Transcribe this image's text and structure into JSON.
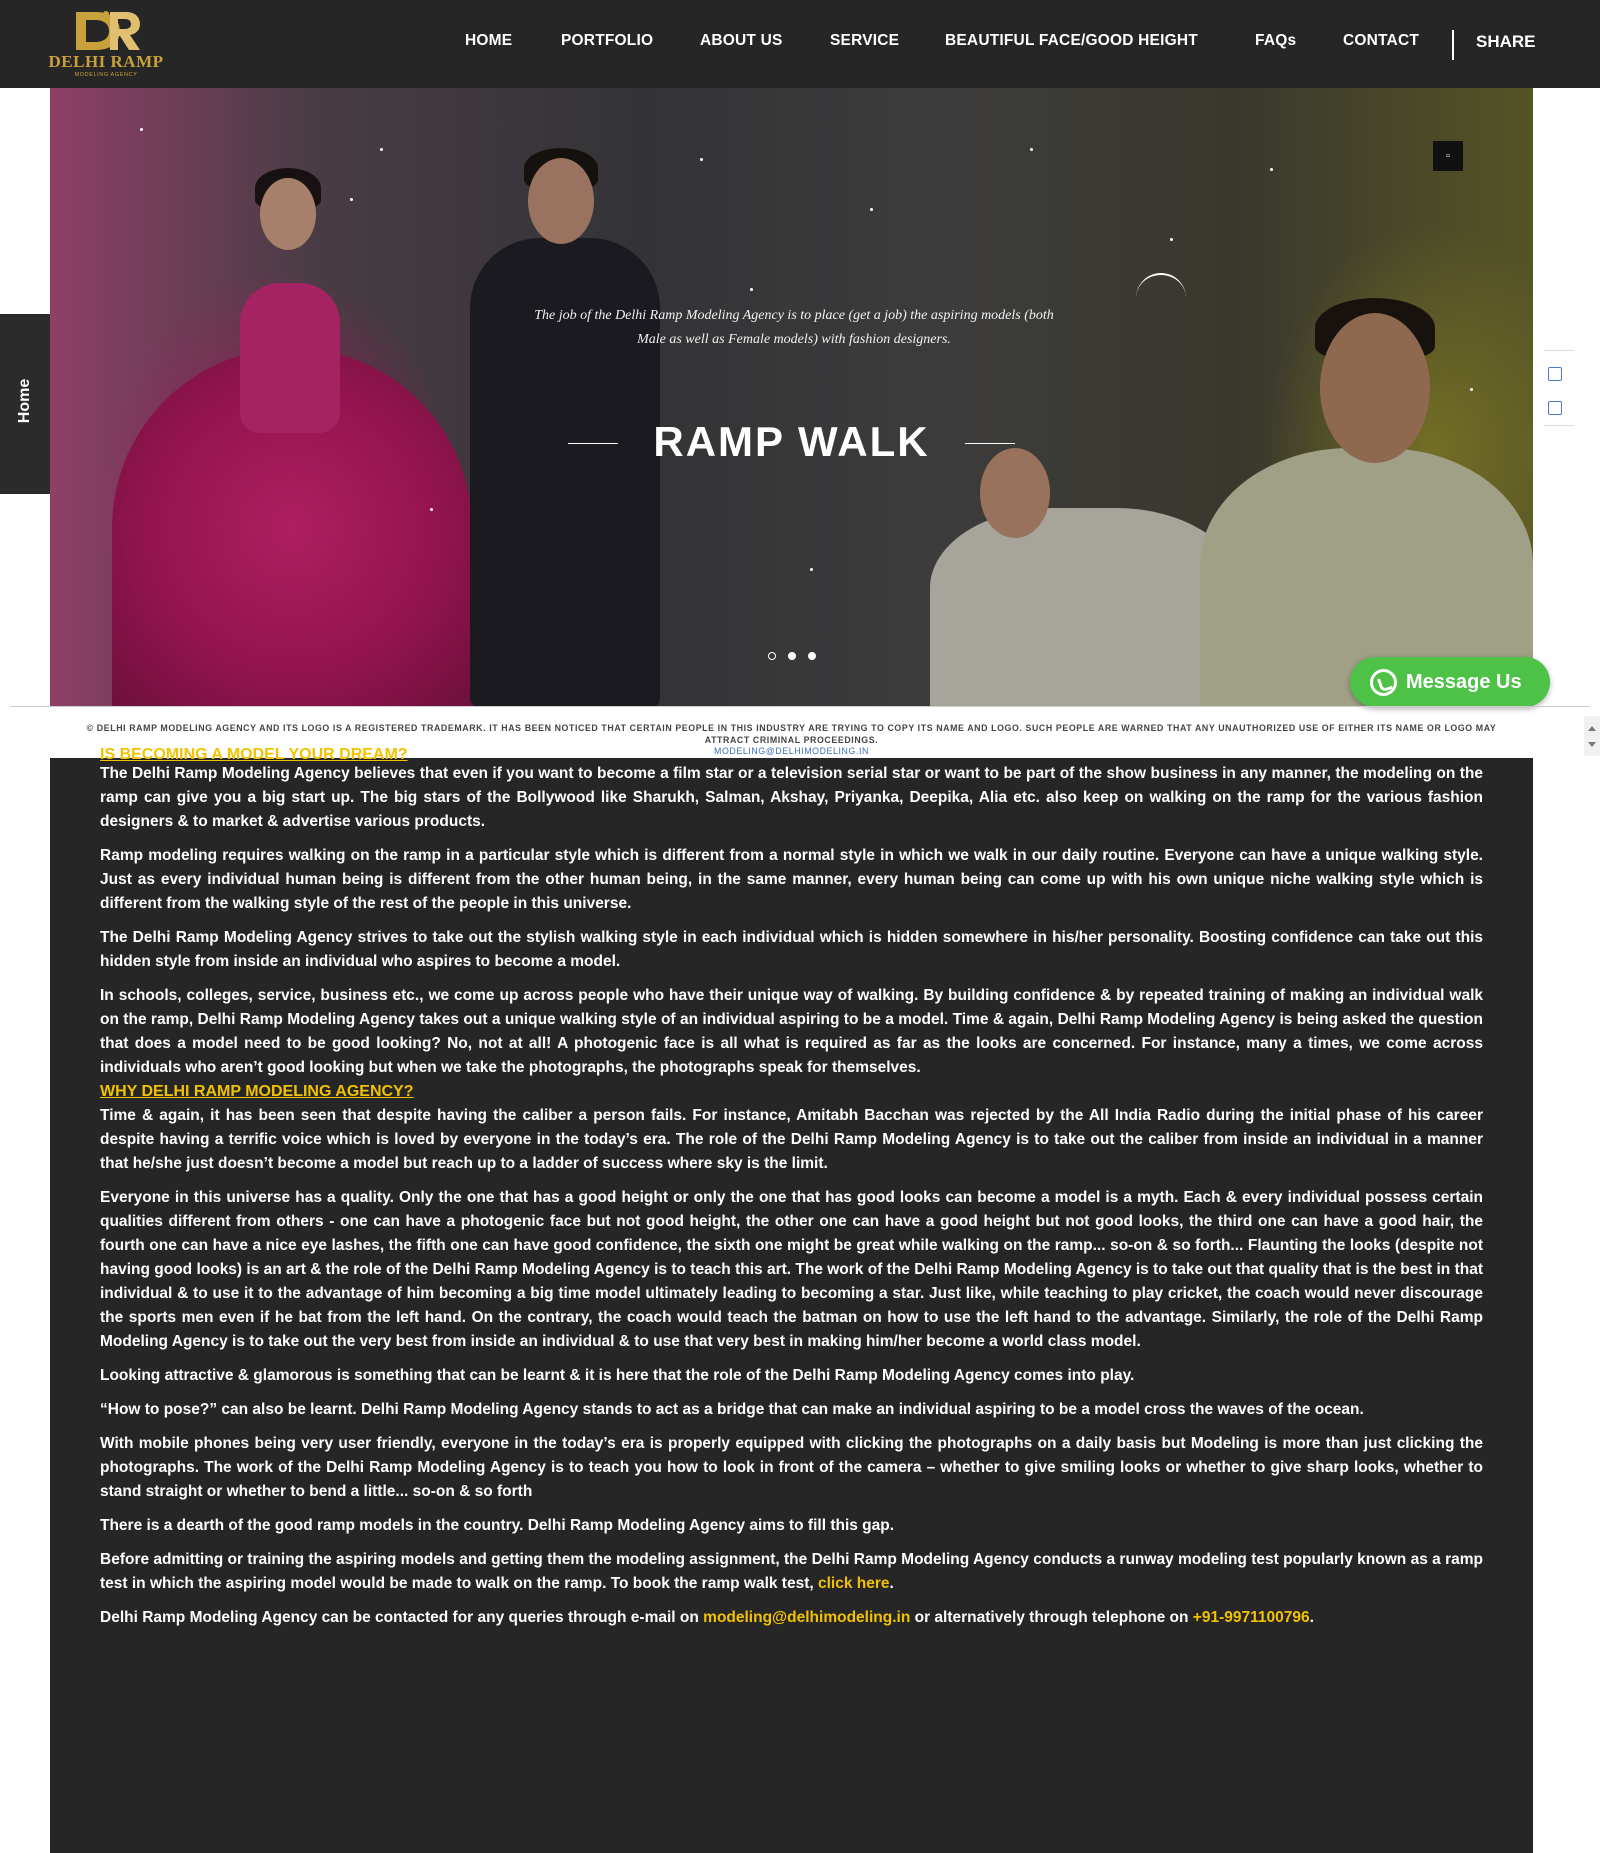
{
  "brand": {
    "logo_mark": "DR",
    "name": "DELHI RAMP",
    "tagline": "MODELING AGENCY",
    "gold": "#c9a13a",
    "accent": "#f2c200"
  },
  "nav": {
    "items": [
      "HOME",
      "PORTFOLIO",
      "ABOUT US",
      "SERVICE",
      "BEAUTIFUL FACE/GOOD HEIGHT",
      "FAQs",
      "CONTACT"
    ],
    "share": "SHARE"
  },
  "hero": {
    "quote": "The job of the Delhi Ramp Modeling Agency is to place (get a job) the aspiring models (both Male as well as Female models) with fashion designers.",
    "title": "RAMP WALK",
    "slide_count": 3,
    "active_slide": 2,
    "control_icon": "square-icon"
  },
  "side_tab": {
    "label": "Home"
  },
  "whatsapp": {
    "label": "Message Us",
    "color": "#4dc247"
  },
  "notice": {
    "text": "© DELHI RAMP MODELING AGENCY AND ITS LOGO IS A REGISTERED TRADEMARK. IT HAS BEEN NOTICED THAT CERTAIN PEOPLE IN THIS INDUSTRY ARE TRYING TO COPY ITS NAME AND LOGO. SUCH PEOPLE ARE WARNED THAT ANY UNAUTHORIZED USE OF EITHER ITS NAME OR LOGO MAY ATTRACT CRIMINAL PROCEEDINGS.",
    "email": "MODELING@DELHIMODELING.IN"
  },
  "article": {
    "heading1": "IS BECOMING A MODEL YOUR DREAM?",
    "p1": "The Delhi Ramp Modeling Agency believes that even if you want to become a film star or a television serial star or want to be part of the show business in any manner, the modeling on the ramp can give you a big start up. The big stars of the Bollywood like Sharukh, Salman, Akshay, Priyanka, Deepika, Alia etc. also keep on walking on the ramp for the various fashion designers & to market & advertise various products.",
    "p2": "Ramp modeling requires walking on the ramp in a particular style which is different from a normal style in which we walk in our daily routine. Everyone can have a unique walking style. Just as every individual human being is different from the other human being, in the same manner, every human being can come up with his own unique niche walking style which is different from the walking style of the rest of the people in this universe.",
    "p3": "The Delhi Ramp Modeling Agency strives to take out the stylish walking style in each individual which is hidden somewhere in his/her personality. Boosting confidence can take out this hidden style from inside an individual who aspires to become a model.",
    "p4": "In schools, colleges, service, business etc., we come up across people who have their unique way of walking. By building confidence & by repeated training of making an individual walk on the ramp, Delhi Ramp Modeling Agency takes out a unique walking style of an individual aspiring to be a model. Time & again, Delhi Ramp Modeling Agency is being asked the question that does a model need to be good looking? No, not at all! A photogenic face is all what is required as far as the looks are concerned. For instance, many a times, we come across individuals who aren’t good looking but when we take the photographs, the photographs speak for themselves.",
    "heading2": "WHY DELHI RAMP MODELING AGENCY?",
    "p5": "Time & again, it has been seen that despite having the caliber a person fails. For instance, Amitabh Bacchan was rejected by the All India Radio during the initial phase of his career despite having a terrific voice which is loved by everyone in the today’s era. The role of the Delhi Ramp Modeling Agency is to take out the caliber from inside an individual in a manner that he/she just doesn’t become a model but reach up to a ladder of success where sky is the limit.",
    "p6": "Everyone in this universe has a quality. Only the one that has a good height or only the one that has good looks can become a model is a myth. Each & every individual possess certain qualities different from others - one can have a photogenic face but not good height, the other one can have a good height but not good looks, the third one can have a good hair, the fourth one can have a nice eye lashes, the fifth one can have good confidence, the sixth one might be great while walking on the ramp... so-on & so forth... Flaunting the looks (despite not having good looks) is an art & the role of the Delhi Ramp Modeling Agency is to teach this art. The work of the Delhi Ramp Modeling Agency is to take out that quality that is the best in that individual & to use it to the advantage of him becoming a big time model ultimately leading to becoming a star. Just like, while teaching to play cricket, the coach would never discourage the sports men even if he bat from the left hand. On the contrary, the coach would teach the batman on how to use the left hand to the advantage. Similarly, the role of the Delhi Ramp Modeling Agency is to take out the very best from inside an individual & to use that very best in making him/her become a world class model.",
    "p7": "Looking attractive & glamorous is something that can be learnt & it is here that the role of the Delhi Ramp Modeling Agency comes into play.",
    "p8": "“How to pose?” can also be learnt. Delhi Ramp Modeling Agency stands to act as a bridge that can make an individual aspiring to be a model cross the waves of the ocean.",
    "p9": "With mobile phones being very user friendly, everyone in the today’s era is properly equipped with clicking the photographs on a daily basis but Modeling is more than just clicking the photographs. The work of the Delhi Ramp Modeling Agency is to teach you how to look in front of the camera – whether to give smiling looks or whether to give sharp looks, whether to stand straight or whether to bend a little... so-on & so forth",
    "p10": "There is a dearth of the good ramp models in the country. Delhi Ramp Modeling Agency aims to fill this gap.",
    "p11_text": "Before admitting or training the aspiring models and getting them the modeling assignment, the Delhi Ramp Modeling Agency conducts a runway modeling test popularly known as a ramp test in which the aspiring model would be made to walk on the ramp. To book the ramp walk test, ",
    "p11_link": "click here",
    "p11_end": ".",
    "p12_text": "Delhi Ramp Modeling Agency can be contacted for any queries through e-mail on ",
    "p12_email": "modeling@delhimodeling.in",
    "p12_mid": " or alternatively through telephone on ",
    "p12_phone": "+91-9971100796",
    "p12_end": "."
  }
}
